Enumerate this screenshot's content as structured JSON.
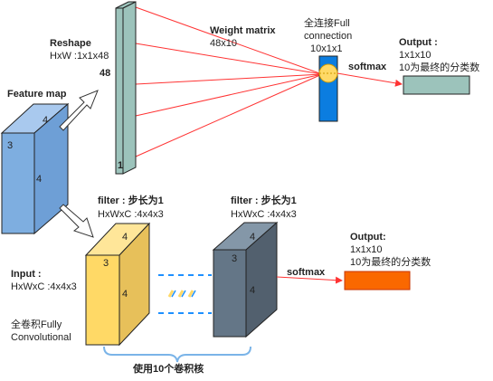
{
  "colors": {
    "feature_map": "#7eaee0",
    "reshape_bar": "#9cc3bb",
    "fc_box": "#0b7de0",
    "fc_circle": "#ffd966",
    "output_fc": "#9cc3bb",
    "filter_yellow": "#ffd966",
    "filter_dark": "#647687",
    "output_conv": "#fa6800",
    "lines_red": "#ff3333",
    "dashes_blue": "#1e90ff",
    "brace_blue": "#7ab4e8"
  },
  "reshape": {
    "title": "Reshape",
    "formula": "HxW :1x1x48",
    "top_label": "48",
    "bottom_label": "1"
  },
  "feature_map": {
    "title": "Feature map",
    "top_num": "4",
    "side_num_left": "3",
    "side_num_center": "4"
  },
  "weight_matrix": {
    "title": "Weight matrix",
    "size": "48x10"
  },
  "fully_connected": {
    "line1": "全连接Full",
    "line2": "connection",
    "size": "10x1x1"
  },
  "softmax_top": "softmax",
  "softmax_bottom": "softmax",
  "output_top": {
    "title": "Output :",
    "size": "1x1x10",
    "desc": "10为最终的分类数"
  },
  "filter_left": {
    "title": "filter : 步长为1",
    "formula": "HxWxC :4x4x3",
    "top_num": "4",
    "side_num_left": "3",
    "side_num_center": "4"
  },
  "filter_right": {
    "title": "filter : 步长为1",
    "formula": "HxWxC :4x4x3",
    "top_num": "4",
    "side_num_left": "3",
    "side_num_center": "4"
  },
  "input": {
    "title": "Input :",
    "formula": "HxWxC :4x4x3"
  },
  "fully_conv": {
    "line1": "全卷积Fully",
    "line2": "Convolutional"
  },
  "output_bottom": {
    "title": "Output:",
    "size": "1x1x10",
    "desc": "10为最终的分类数"
  },
  "kernel_note": "使用10个卷积核"
}
